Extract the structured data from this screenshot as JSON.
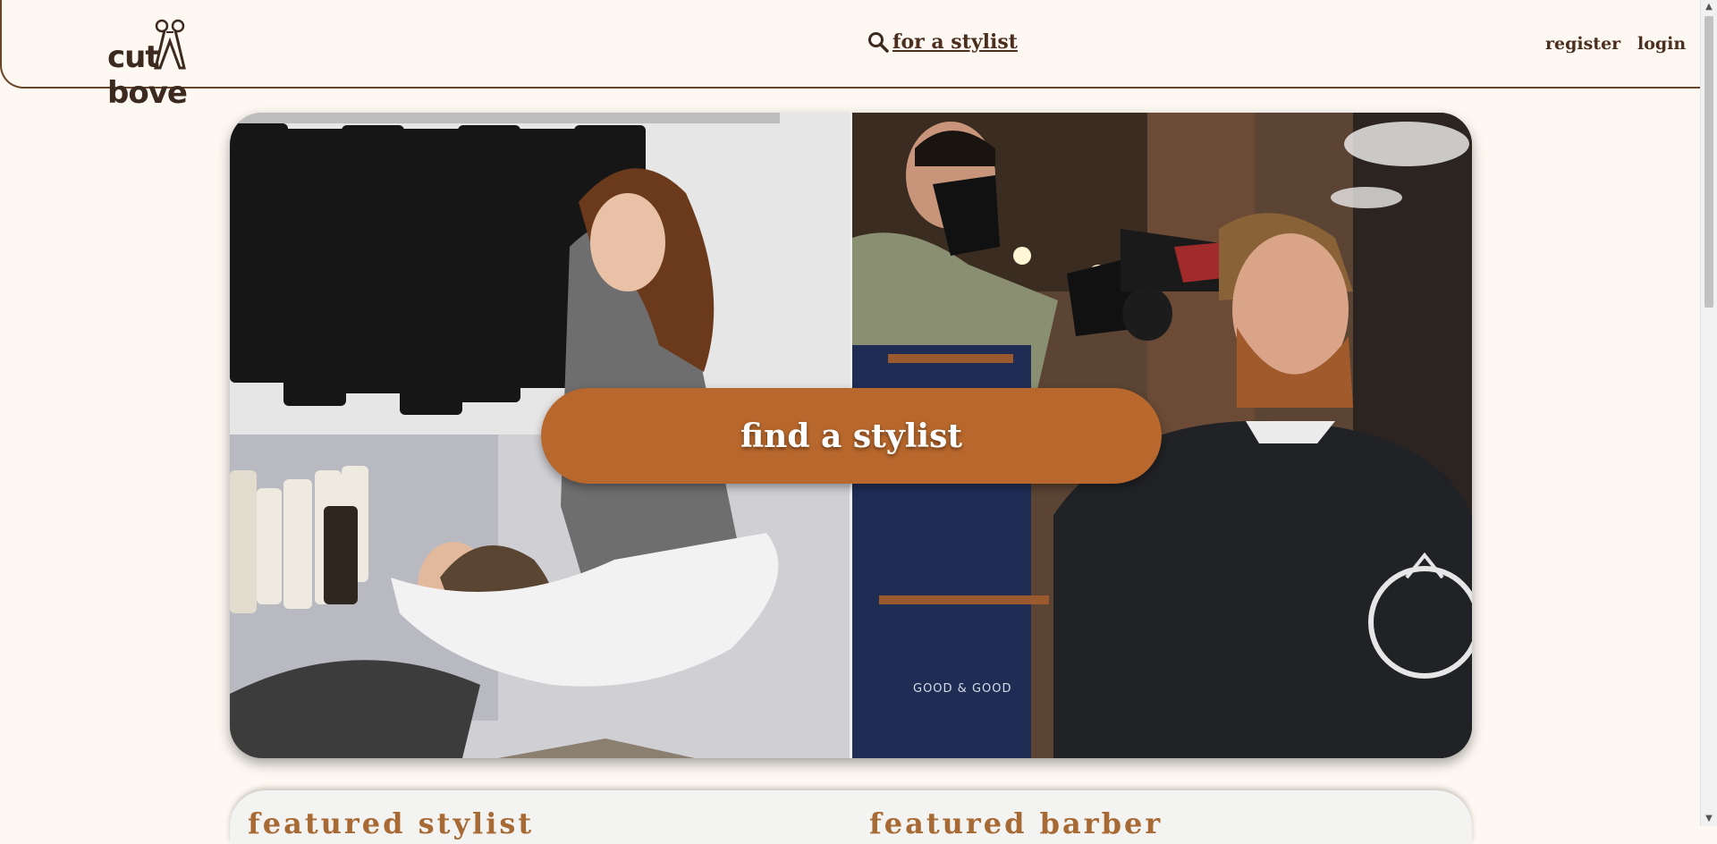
{
  "header": {
    "logo_left": "cut",
    "logo_right": "bove",
    "search_link": "for a stylist",
    "register": "register",
    "login": "login"
  },
  "hero": {
    "cta_label": "find a stylist",
    "left_image": "salon hair washing photo",
    "right_image": "barber blow-drying photo",
    "apron_text": "GOOD & GOOD"
  },
  "featured": {
    "stylist_title": "featured stylist",
    "barber_title": "featured barber"
  },
  "colors": {
    "background": "#fdf8f1",
    "accent": "#b8682c",
    "text": "#4b2e1e"
  }
}
